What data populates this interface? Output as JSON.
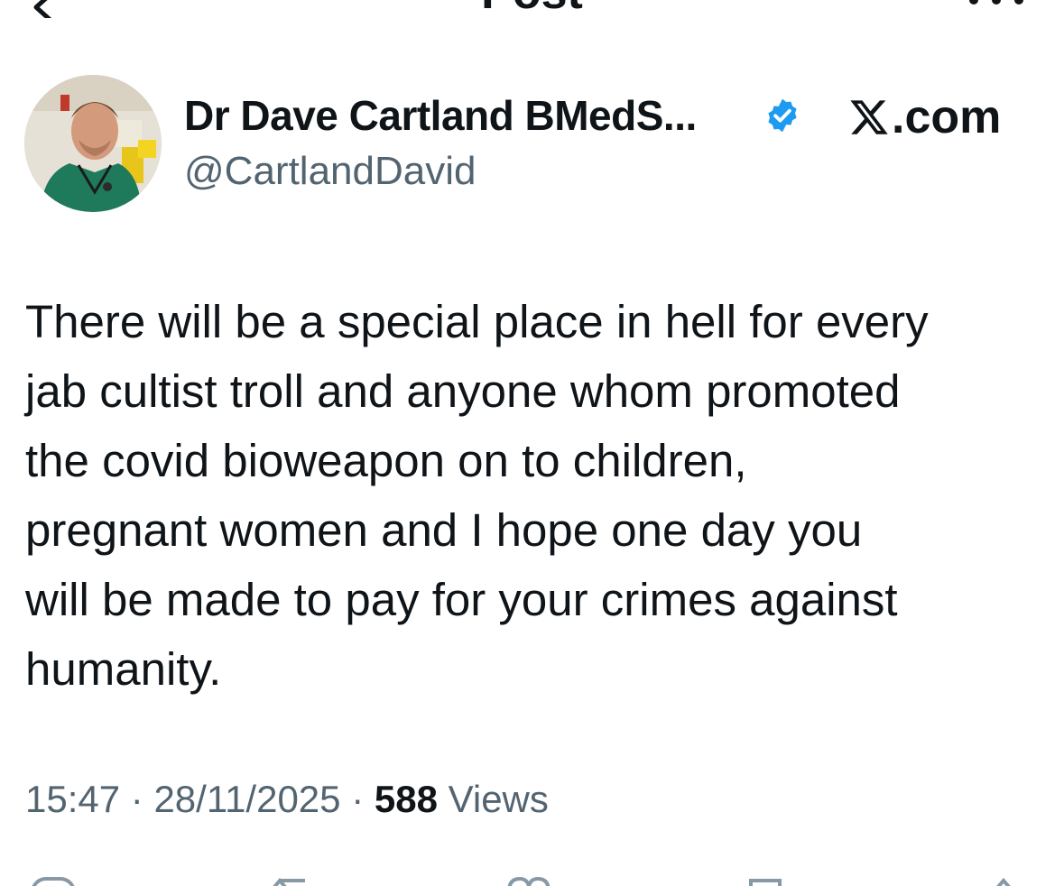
{
  "header": {
    "title": "Post"
  },
  "post": {
    "author_name": "Dr Dave Cartland BMedS...",
    "author_handle": "@CartlandDavid",
    "source_logo": ".com",
    "text": "There will be a special place in hell for every\njab cultist troll and anyone whom promoted\nthe covid bioweapon on to children,\npregnant women and I hope one day you\nwill be made to pay for your crimes against\nhumanity.",
    "time": "15:47",
    "separator": " · ",
    "date": "28/11/2025",
    "views_count": "588",
    "views_label": " Views"
  },
  "icons": {
    "back": "chevron-left-icon",
    "more": "more-horizontal-icon",
    "verified": "verified-badge-icon",
    "actions": [
      "reply-icon",
      "repost-icon",
      "like-icon",
      "bookmark-icon",
      "share-icon"
    ]
  },
  "colors": {
    "text_primary": "#0f1419",
    "text_secondary": "#536471",
    "verified_blue": "#1d9bf0"
  }
}
